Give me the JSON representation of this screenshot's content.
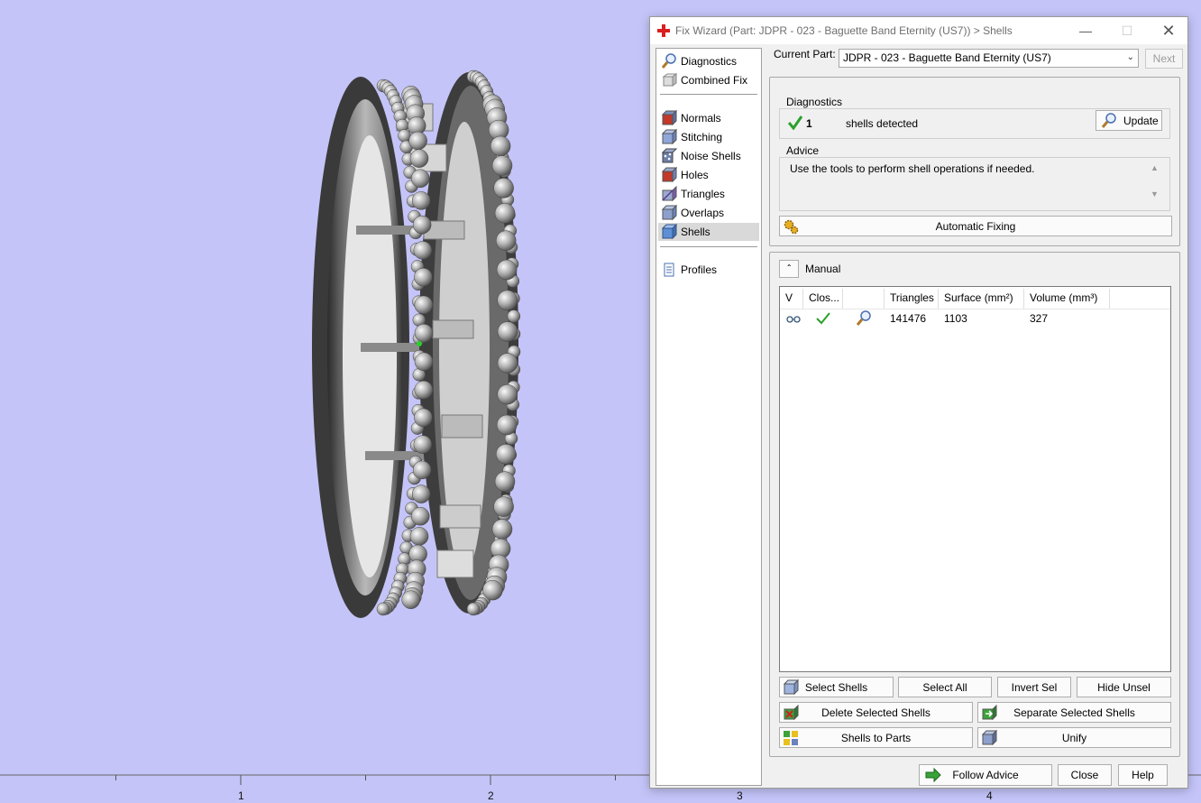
{
  "window": {
    "title": "Fix Wizard (Part: JDPR - 023 - Baguette Band Eternity (US7)) > Shells",
    "minimize_icon": "minimize-icon",
    "maximize_icon": "maximize-icon",
    "close_icon": "close-icon"
  },
  "ruler": {
    "labels": [
      "1",
      "2",
      "3",
      "4"
    ]
  },
  "nav": {
    "groups": [
      [
        {
          "label": "Diagnostics",
          "icon": "magnifier-icon"
        },
        {
          "label": "Combined Fix",
          "icon": "cube-icon"
        }
      ],
      [
        {
          "label": "Normals",
          "icon": "normals-icon"
        },
        {
          "label": "Stitching",
          "icon": "stitching-icon"
        },
        {
          "label": "Noise Shells",
          "icon": "noise-shells-icon"
        },
        {
          "label": "Holes",
          "icon": "holes-icon"
        },
        {
          "label": "Triangles",
          "icon": "triangles-icon"
        },
        {
          "label": "Overlaps",
          "icon": "overlaps-icon"
        },
        {
          "label": "Shells",
          "icon": "shells-icon",
          "active": true
        }
      ],
      [
        {
          "label": "Profiles",
          "icon": "document-icon"
        }
      ]
    ]
  },
  "top": {
    "current_part_label": "Current Part:",
    "current_part_value": "JDPR - 023 - Baguette Band Eternity (US7)",
    "next_label": "Next"
  },
  "diagnostics": {
    "group_label": "Diagnostics",
    "count": "1",
    "status_text": "shells detected",
    "update_label": "Update"
  },
  "advice": {
    "group_label": "Advice",
    "text": "Use the tools to perform shell operations if needed."
  },
  "automatic_fixing_label": "Automatic Fixing",
  "manual": {
    "label": "Manual",
    "columns": [
      "V",
      "Clos...",
      "",
      "Triangles",
      "Surface (mm²)",
      "Volume (mm³)"
    ],
    "rows": [
      {
        "visible_icon": "glasses-icon",
        "closed_icon": "checkmark-icon",
        "zoom_icon": "magnifier-icon",
        "triangles": "141476",
        "surface": "1103",
        "volume": "327"
      }
    ]
  },
  "actions": {
    "select_shells": "Select Shells",
    "select_all": "Select All",
    "invert_sel": "Invert Sel",
    "hide_unsel": "Hide Unsel",
    "delete_selected": "Delete Selected Shells",
    "separate_selected": "Separate Selected Shells",
    "shells_to_parts": "Shells to Parts",
    "unify": "Unify"
  },
  "footer": {
    "follow_advice": "Follow Advice",
    "close": "Close",
    "help": "Help"
  },
  "colors": {
    "viewport_bg": "#c4c4f8",
    "dialog_bg": "#f0f0f0",
    "accent_red": "#d92020",
    "check_green": "#2aa12a"
  }
}
